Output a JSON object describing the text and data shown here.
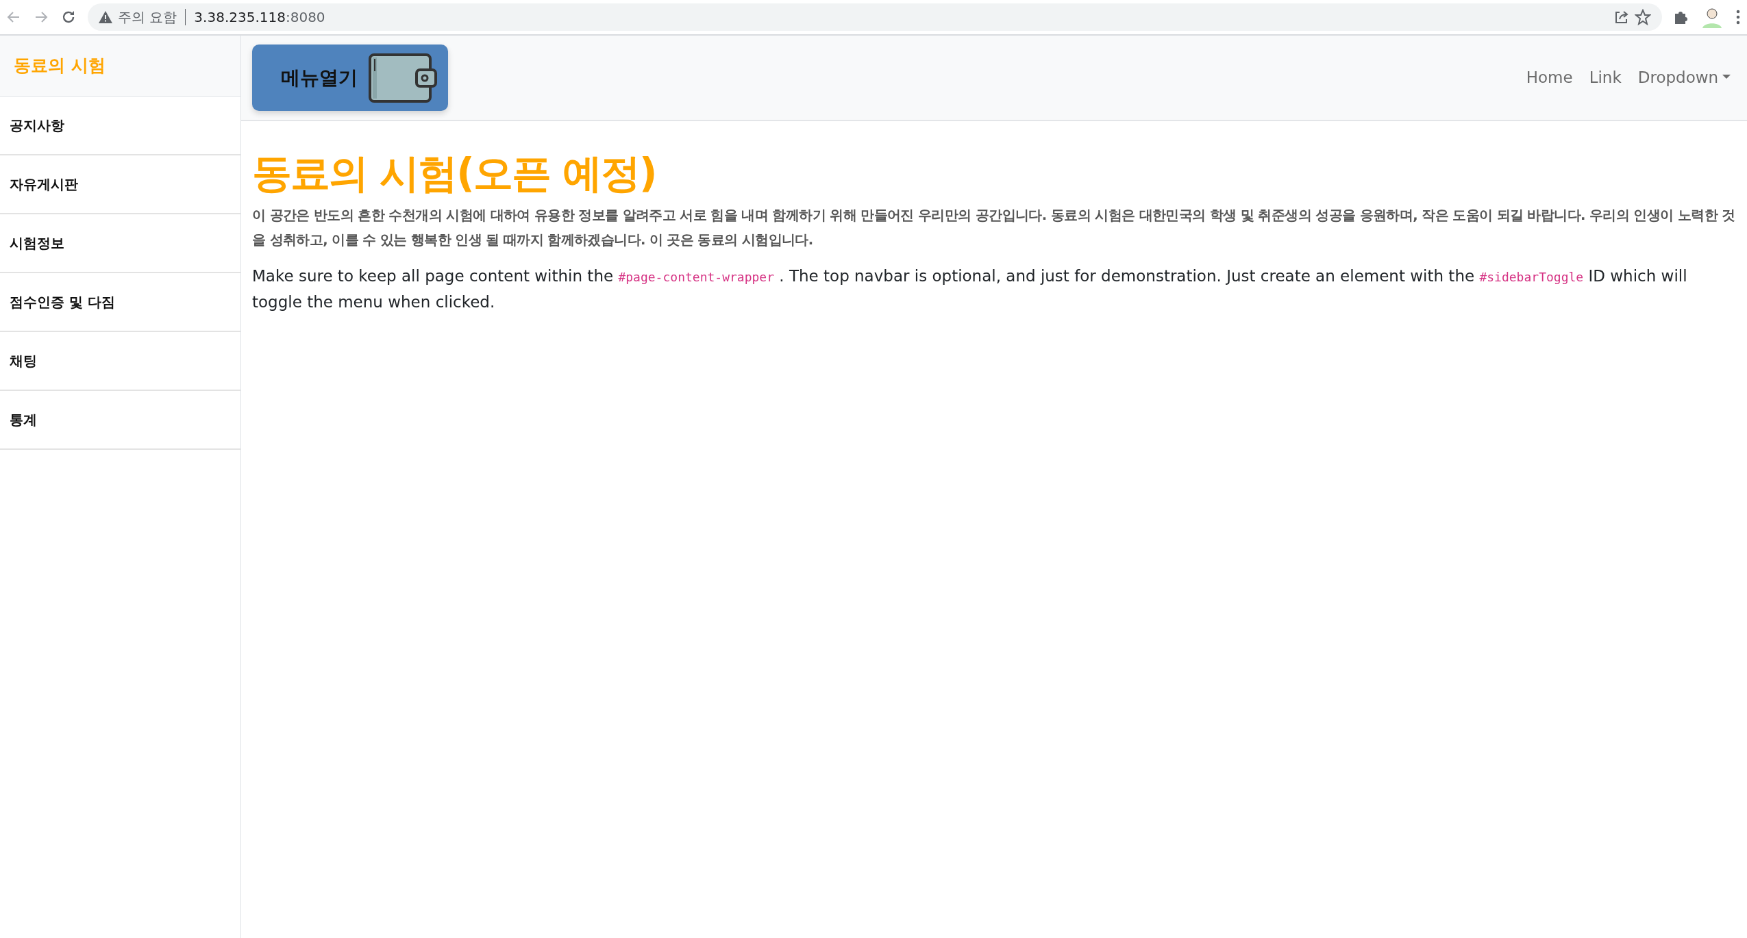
{
  "browser": {
    "warning": "주의 요함",
    "host": "3.38.235.118",
    "port": ":8080"
  },
  "sidebar": {
    "heading": "동료의 시험",
    "items": [
      "공지사항",
      "자유게시판",
      "시험정보",
      "점수인증 및 다짐",
      "채팅",
      "통계"
    ]
  },
  "navbar": {
    "toggle_label": "메뉴열기",
    "links": [
      {
        "label": "Home",
        "kind": "link"
      },
      {
        "label": "Link",
        "kind": "link"
      },
      {
        "label": "Dropdown",
        "kind": "dropdown"
      }
    ]
  },
  "content": {
    "title": "동료의 시험(오픈 예정)",
    "intro": "이 공간은 반도의 흔한 수천개의 시험에 대하여 유용한 정보를 알려주고 서로 힘을 내며 함께하기 위해 만들어진 우리만의 공간입니다. 동료의 시험은 대한민국의 학생 및 취준생의 성공을 응원하며, 작은 도움이 되길 바랍니다. 우리의 인생이 노력한 것을 성취하고, 이를 수 있는 행복한 인생 될 때까지 함께하겠습니다. 이 곳은 동료의 시험입니다.",
    "note": [
      {
        "kind": "text",
        "text": "Make sure to keep all page content within the "
      },
      {
        "kind": "code",
        "text": "#page-content-wrapper"
      },
      {
        "kind": "text",
        "text": " . The top navbar is optional, and just for demonstration. Just create an element with the "
      },
      {
        "kind": "code",
        "text": "#sidebarToggle"
      },
      {
        "kind": "text",
        "text": " ID which will toggle the menu when clicked."
      }
    ]
  }
}
